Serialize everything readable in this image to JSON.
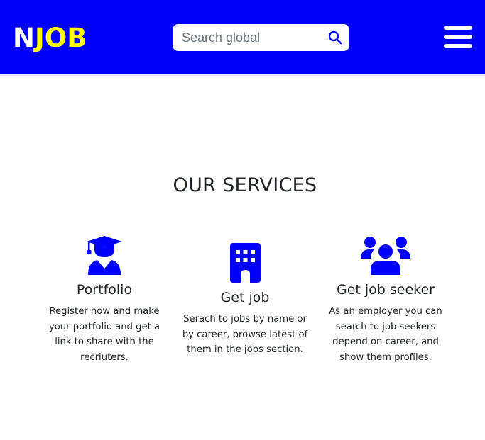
{
  "brand": {
    "first": "N",
    "rest": "JOB"
  },
  "search": {
    "placeholder": "Search global"
  },
  "section": {
    "title": "OUR SERVICES"
  },
  "services": [
    {
      "title": "Portfolio",
      "description": "Register now and make your portfolio and get a link to share with the recriuters.",
      "icon": "graduate-icon"
    },
    {
      "title": "Get job",
      "description": "Serach to jobs by name or by career, browse latest of them in the jobs section.",
      "icon": "building-icon"
    },
    {
      "title": "Get job seeker",
      "description": "As an employer you can search to job seekers depend on career, and show them profiles.",
      "icon": "users-icon"
    }
  ],
  "colors": {
    "primary": "#0000ff",
    "accent": "#ffff00",
    "text": "#212529"
  }
}
